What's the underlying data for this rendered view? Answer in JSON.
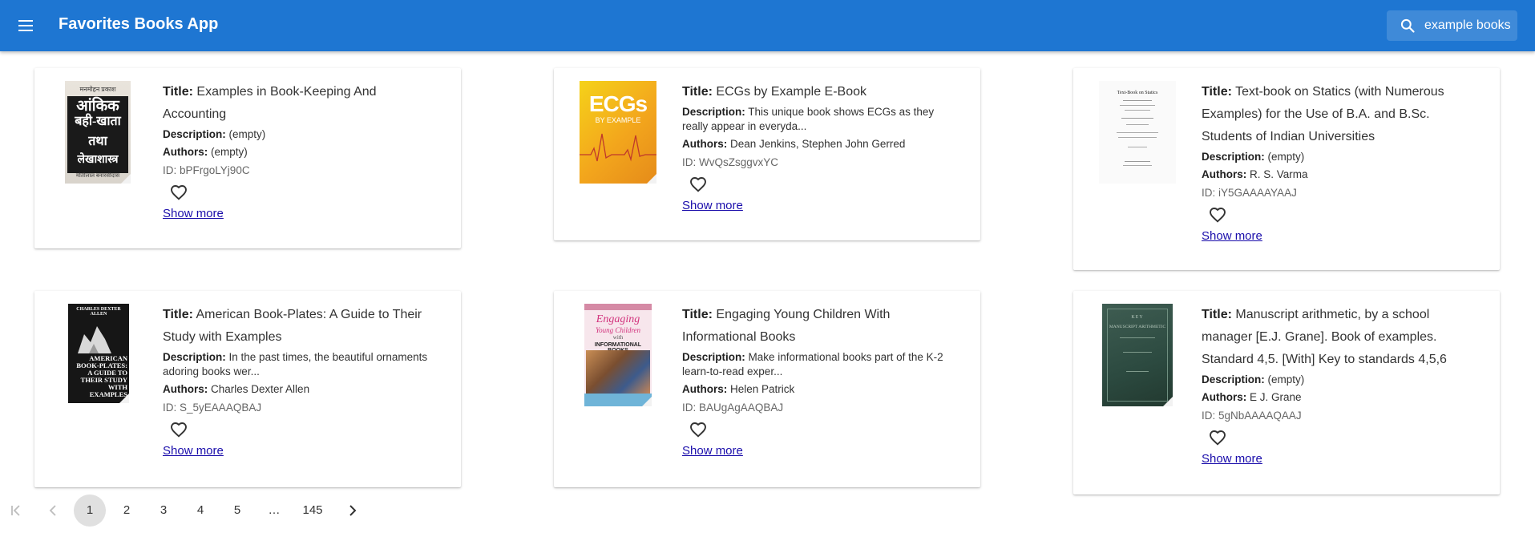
{
  "app": {
    "title": "Favorites Books App"
  },
  "search": {
    "value": "example books"
  },
  "labels": {
    "title": "Title:",
    "description": "Description:",
    "authors": "Authors:",
    "id": "ID:",
    "show_more": "Show more"
  },
  "books": [
    {
      "title": "Examples in Book-Keeping And Accounting",
      "description": "(empty)",
      "authors": "(empty)",
      "id": "bPFrgoLYj90C"
    },
    {
      "title": "ECGs by Example E-Book",
      "description": "This unique book shows ECGs as they really appear in everyda...",
      "authors": "Dean Jenkins, Stephen John Gerred",
      "id": "WvQsZsggvxYC"
    },
    {
      "title": "Text-book on Statics (with Numerous Examples) for the Use of B.A. and B.Sc. Students of Indian Universities",
      "description": "(empty)",
      "authors": "R. S. Varma",
      "id": "iY5GAAAAYAAJ"
    },
    {
      "title": "American Book-Plates: A Guide to Their Study with Examples",
      "description": "In the past times, the beautiful ornaments adoring books wer...",
      "authors": "Charles Dexter Allen",
      "id": "S_5yEAAAQBAJ"
    },
    {
      "title": "Engaging Young Children With Informational Books",
      "description": "Make informational books part of the K-2 learn-to-read exper...",
      "authors": "Helen Patrick",
      "id": "BAUgAgAAQBAJ"
    },
    {
      "title": "Manuscript arithmetic, by a school manager [E.J. Grane]. Book of examples. Standard 4,5. [With] Key to standards 4,5,6",
      "description": "(empty)",
      "authors": "E J. Grane",
      "id": "5gNbAAAAQAAJ"
    }
  ],
  "covers": {
    "b1": {
      "line1": "मनमोहन प्रकाश",
      "line2": "आंकिक",
      "line3": "बही-खाता",
      "line4": "तथा",
      "line5": "लेखाशास्त्र",
      "line6": "मोतीलाल बनारसीदास"
    },
    "b2": {
      "line1": "ECGs",
      "line2": "BY EXAMPLE"
    },
    "b3": {
      "line1": "Text-Book on Statics"
    },
    "b4": {
      "line1": "CHARLES DEXTER ALLEN",
      "line2": "AMERICAN BOOK-PLATES: A GUIDE TO THEIR STUDY WITH EXAMPLES"
    },
    "b5": {
      "line1": "Engaging",
      "line2": "Young Children",
      "line3": "with",
      "line4": "INFORMATIONAL BOOKS"
    },
    "b6": {
      "line1": "KEY",
      "line2": "MANUSCRIPT ARITHMETIC"
    }
  },
  "pagination": {
    "first_icon": "first-page-icon",
    "prev_icon": "chevron-left-icon",
    "next_icon": "chevron-right-icon",
    "pages": [
      "1",
      "2",
      "3",
      "4",
      "5",
      "…",
      "145"
    ],
    "current": "1"
  }
}
